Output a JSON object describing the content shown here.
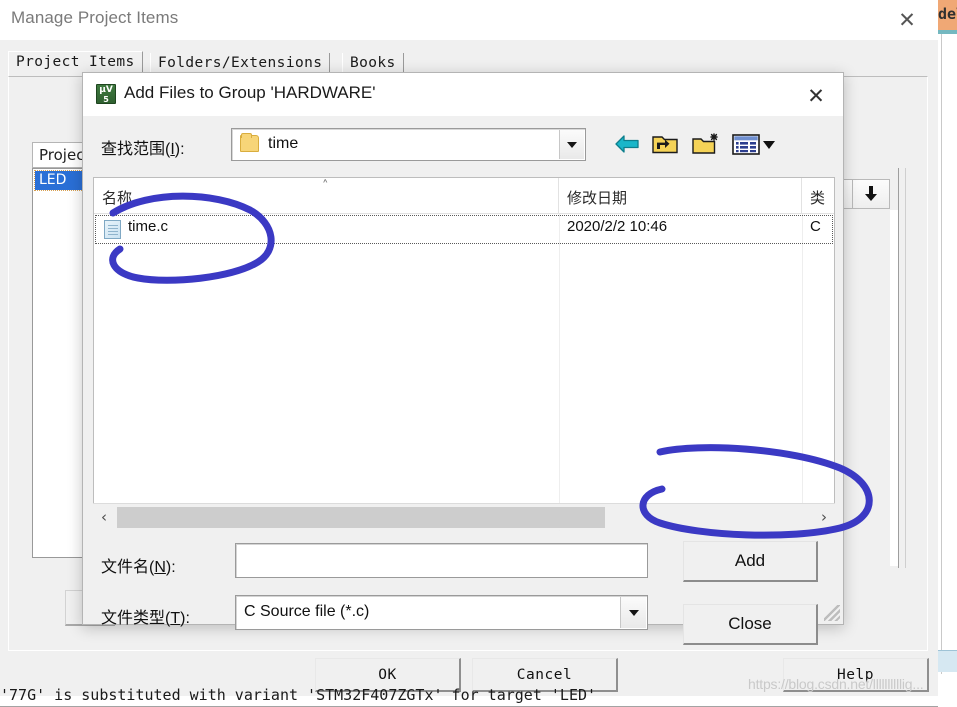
{
  "background_window": {
    "title": "Manage Project Items",
    "close_icon": "✕",
    "tabs": [
      {
        "label": "Project Items"
      },
      {
        "label": "Folders/Extensions"
      },
      {
        "label": "Books"
      }
    ],
    "project_list": {
      "header": "Project",
      "selected_item": "LED"
    },
    "buttons": [
      {
        "label": "OK"
      },
      {
        "label": "Cancel"
      },
      {
        "label": "Help"
      }
    ],
    "status_text": "'77G' is substituted with variant 'STM32F407ZGTx' for target 'LED'",
    "watermark": "https://blog.csdn.net/llllllllllig..."
  },
  "editor_edge": {
    "tab_label": "dela"
  },
  "dialog": {
    "title": "Add Files to Group 'HARDWARE'",
    "icon_top": "μV",
    "icon_bottom": "5",
    "close_icon": "✕",
    "look_in": {
      "label_prefix": "查找范围(",
      "label_accel": "I",
      "label_suffix": "):",
      "value": "time",
      "folder_icon": "folder-icon",
      "dropdown_icon": "chevron-down-icon"
    },
    "toolbar": [
      {
        "name": "back-icon",
        "tooltip": "返回"
      },
      {
        "name": "up-folder-icon",
        "tooltip": "上一级"
      },
      {
        "name": "new-folder-icon",
        "tooltip": "新建文件夹"
      },
      {
        "name": "view-mode-icon",
        "tooltip": "视图"
      }
    ],
    "file_list": {
      "columns": [
        "名称",
        "修改日期",
        "类"
      ],
      "sort_caret": "˄",
      "rows": [
        {
          "name": "time.c",
          "date": "2020/2/2 10:46",
          "type": "C "
        }
      ]
    },
    "scrollbar": {
      "left_arrow": "‹",
      "right_arrow": "›"
    },
    "file_name": {
      "label_prefix": "文件名(",
      "label_accel": "N",
      "label_suffix": "):",
      "value": "",
      "placeholder": ""
    },
    "file_type": {
      "label_prefix": "文件类型(",
      "label_accel": "T",
      "label_suffix": "):",
      "value": "C Source file (*.c)",
      "dropdown_icon": "chevron-down-icon"
    },
    "buttons": [
      {
        "label": "Add"
      },
      {
        "label": "Close"
      }
    ]
  },
  "annotations": {
    "color": "#3b39c4",
    "stroke_width": 7,
    "shapes": [
      {
        "name": "circle-around-file-row",
        "type": "ellipse"
      },
      {
        "name": "circle-around-add-button",
        "type": "ellipse"
      }
    ]
  }
}
